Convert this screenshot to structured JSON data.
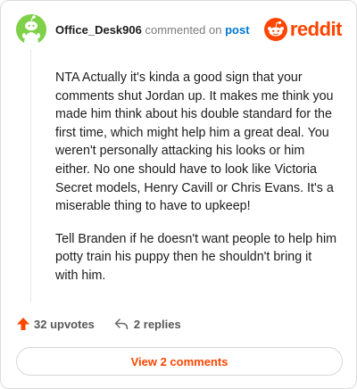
{
  "header": {
    "username": "Office_Desk906",
    "action_text": "commented on",
    "post_link": "post",
    "brand": "reddit"
  },
  "comment": {
    "paragraphs": [
      "NTA Actually it's kinda a good sign that your comments shut Jordan up. It makes me think you made him think about his double standard for the first time, which might help him a great deal. You weren't personally attacking his looks or him either. No one should have to look like Victoria Secret models, Henry Cavill or Chris Evans. It's a miserable thing to have to upkeep!",
      "Tell Branden if he doesn't want people to help him potty train his puppy then he shouldn't bring it with him."
    ]
  },
  "footer": {
    "upvotes_label": "32 upvotes",
    "replies_label": "2 replies"
  },
  "view_button_label": "View 2 comments",
  "colors": {
    "accent": "#ff4500",
    "link": "#0079d3",
    "avatar_bg": "#7fd14a"
  },
  "icons": [
    "snoo-avatar-icon",
    "reddit-logo-icon",
    "upvote-arrow-icon",
    "reply-arrow-icon"
  ]
}
